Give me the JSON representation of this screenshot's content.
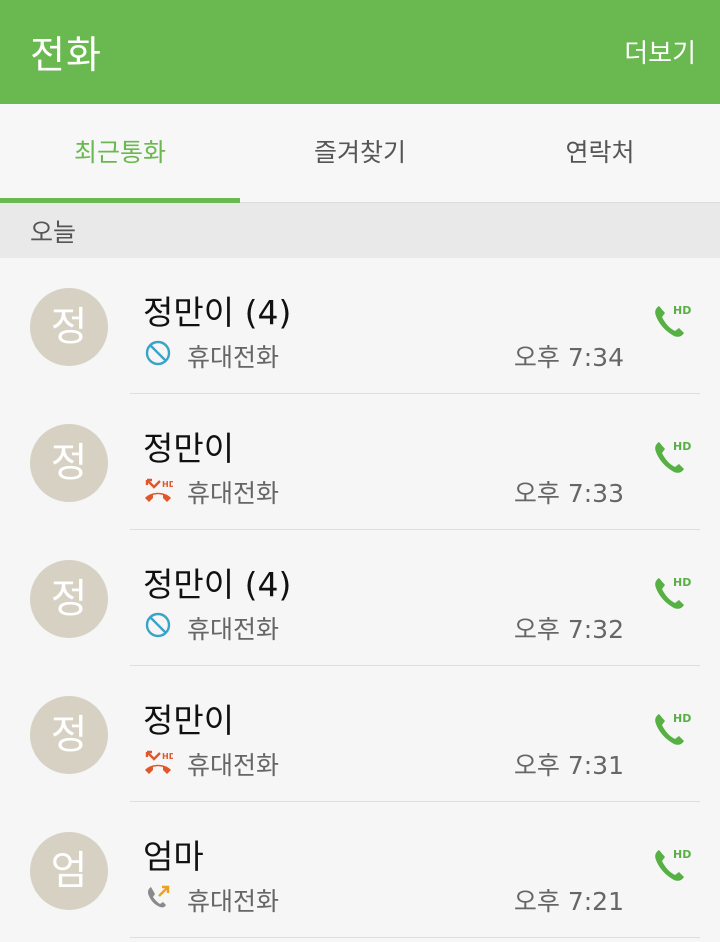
{
  "app": {
    "title": "전화",
    "more_label": "더보기",
    "accent_color": "#6ab850"
  },
  "tabs": [
    {
      "label": "최근통화",
      "active": true
    },
    {
      "label": "즐겨찾기",
      "active": false
    },
    {
      "label": "연락처",
      "active": false
    }
  ],
  "section": {
    "header": "오늘"
  },
  "calls": [
    {
      "avatar": "정",
      "name": "정만이 (4)",
      "type": "휴대전화",
      "time": "오후 7:34",
      "status_icon": "blocked-icon",
      "action_icon": "hd-call-icon"
    },
    {
      "avatar": "정",
      "name": "정만이",
      "type": "휴대전화",
      "time": "오후 7:33",
      "status_icon": "missed-call-hd-icon",
      "action_icon": "hd-call-icon"
    },
    {
      "avatar": "정",
      "name": "정만이 (4)",
      "type": "휴대전화",
      "time": "오후 7:32",
      "status_icon": "blocked-icon",
      "action_icon": "hd-call-icon"
    },
    {
      "avatar": "정",
      "name": "정만이",
      "type": "휴대전화",
      "time": "오후 7:31",
      "status_icon": "missed-call-hd-icon",
      "action_icon": "hd-call-icon"
    },
    {
      "avatar": "엄",
      "name": "엄마",
      "type": "휴대전화",
      "time": "오후 7:21",
      "status_icon": "outgoing-call-icon",
      "action_icon": "hd-call-icon"
    }
  ]
}
